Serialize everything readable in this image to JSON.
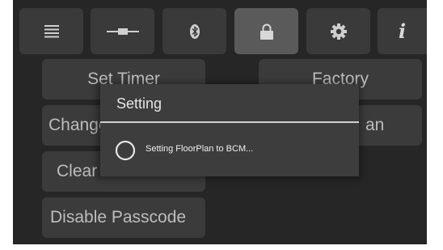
{
  "toolbar": {
    "buttons": [
      {
        "icon": "list-icon",
        "active": false
      },
      {
        "icon": "connector-icon",
        "active": false
      },
      {
        "icon": "bluetooth-icon",
        "active": false
      },
      {
        "icon": "lock-icon",
        "active": true
      },
      {
        "icon": "gear-icon",
        "active": false
      },
      {
        "icon": "info-icon",
        "active": false
      }
    ],
    "info_glyph": "i"
  },
  "menu": {
    "set_timer": "Set Timer",
    "factory": "Factory",
    "change": "Change",
    "plan": "an",
    "clear": "Clear",
    "disable_passcode": "Disable Passcode"
  },
  "dialog": {
    "title": "Setting",
    "message": "Setting FloorPlan to BCM..."
  },
  "colors": {
    "background": "#262626",
    "button": "#3b3b3b",
    "active_tab": "#5a5a5a",
    "dialog": "#3d3d3d",
    "text": "#bdbdbd"
  }
}
